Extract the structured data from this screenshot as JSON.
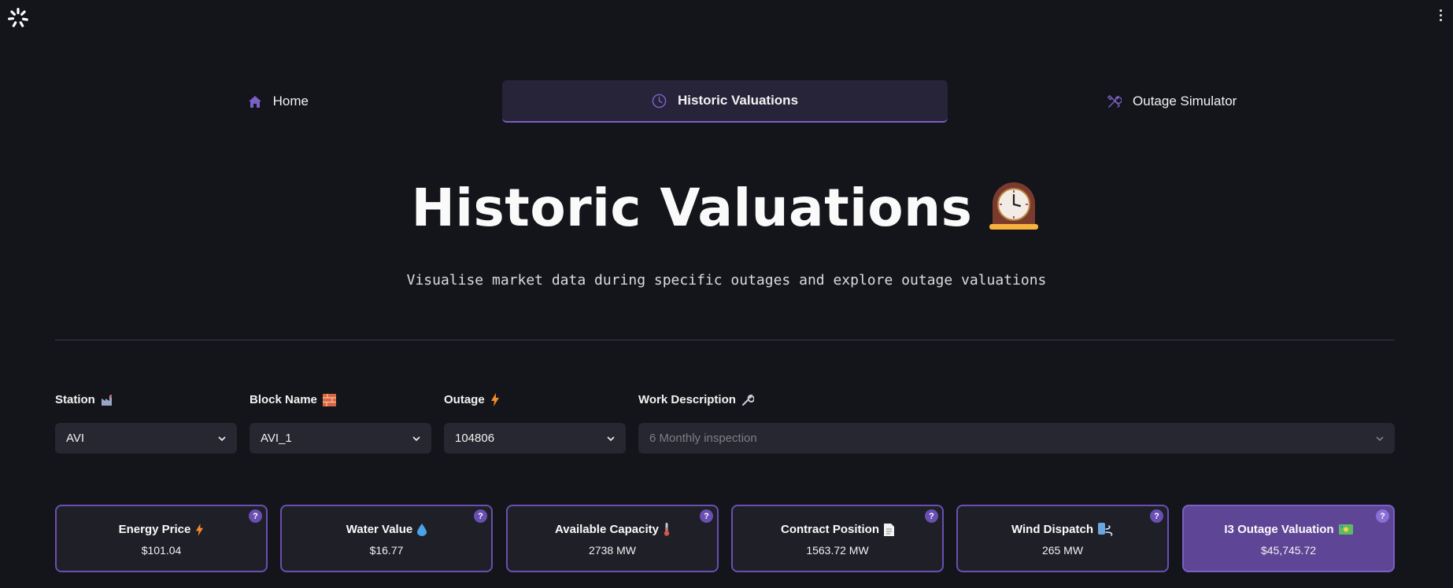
{
  "nav": {
    "home": "Home",
    "historic": "Historic Valuations",
    "simulator": "Outage Simulator"
  },
  "header": {
    "title": "Historic Valuations",
    "subtitle": "Visualise market data during specific outages and explore outage valuations"
  },
  "filters": {
    "station": {
      "label": "Station",
      "value": "AVI",
      "icon": "factory-icon"
    },
    "block": {
      "label": "Block Name",
      "value": "AVI_1",
      "icon": "brick-icon"
    },
    "outage": {
      "label": "Outage",
      "value": "104806",
      "icon": "lightning-icon"
    },
    "work": {
      "label": "Work Description",
      "value": "6 Monthly inspection",
      "icon": "wrench-icon"
    }
  },
  "metrics": [
    {
      "label": "Energy Price",
      "value": "$101.04",
      "icon": "lightning-icon"
    },
    {
      "label": "Water Value",
      "value": "$16.77",
      "icon": "droplet-icon"
    },
    {
      "label": "Available Capacity",
      "value": "2738 MW",
      "icon": "thermometer-icon"
    },
    {
      "label": "Contract Position",
      "value": "1563.72 MW",
      "icon": "document-icon"
    },
    {
      "label": "Wind Dispatch",
      "value": "265 MW",
      "icon": "wind-icon"
    },
    {
      "label": "I3 Outage Valuation",
      "value": "$45,745.72",
      "icon": "money-icon"
    }
  ],
  "help_symbol": "?",
  "colors": {
    "accent": "#6a4fb3",
    "background": "#14151a",
    "active_tab": "#272338",
    "highlight_card": "#5e4596"
  }
}
